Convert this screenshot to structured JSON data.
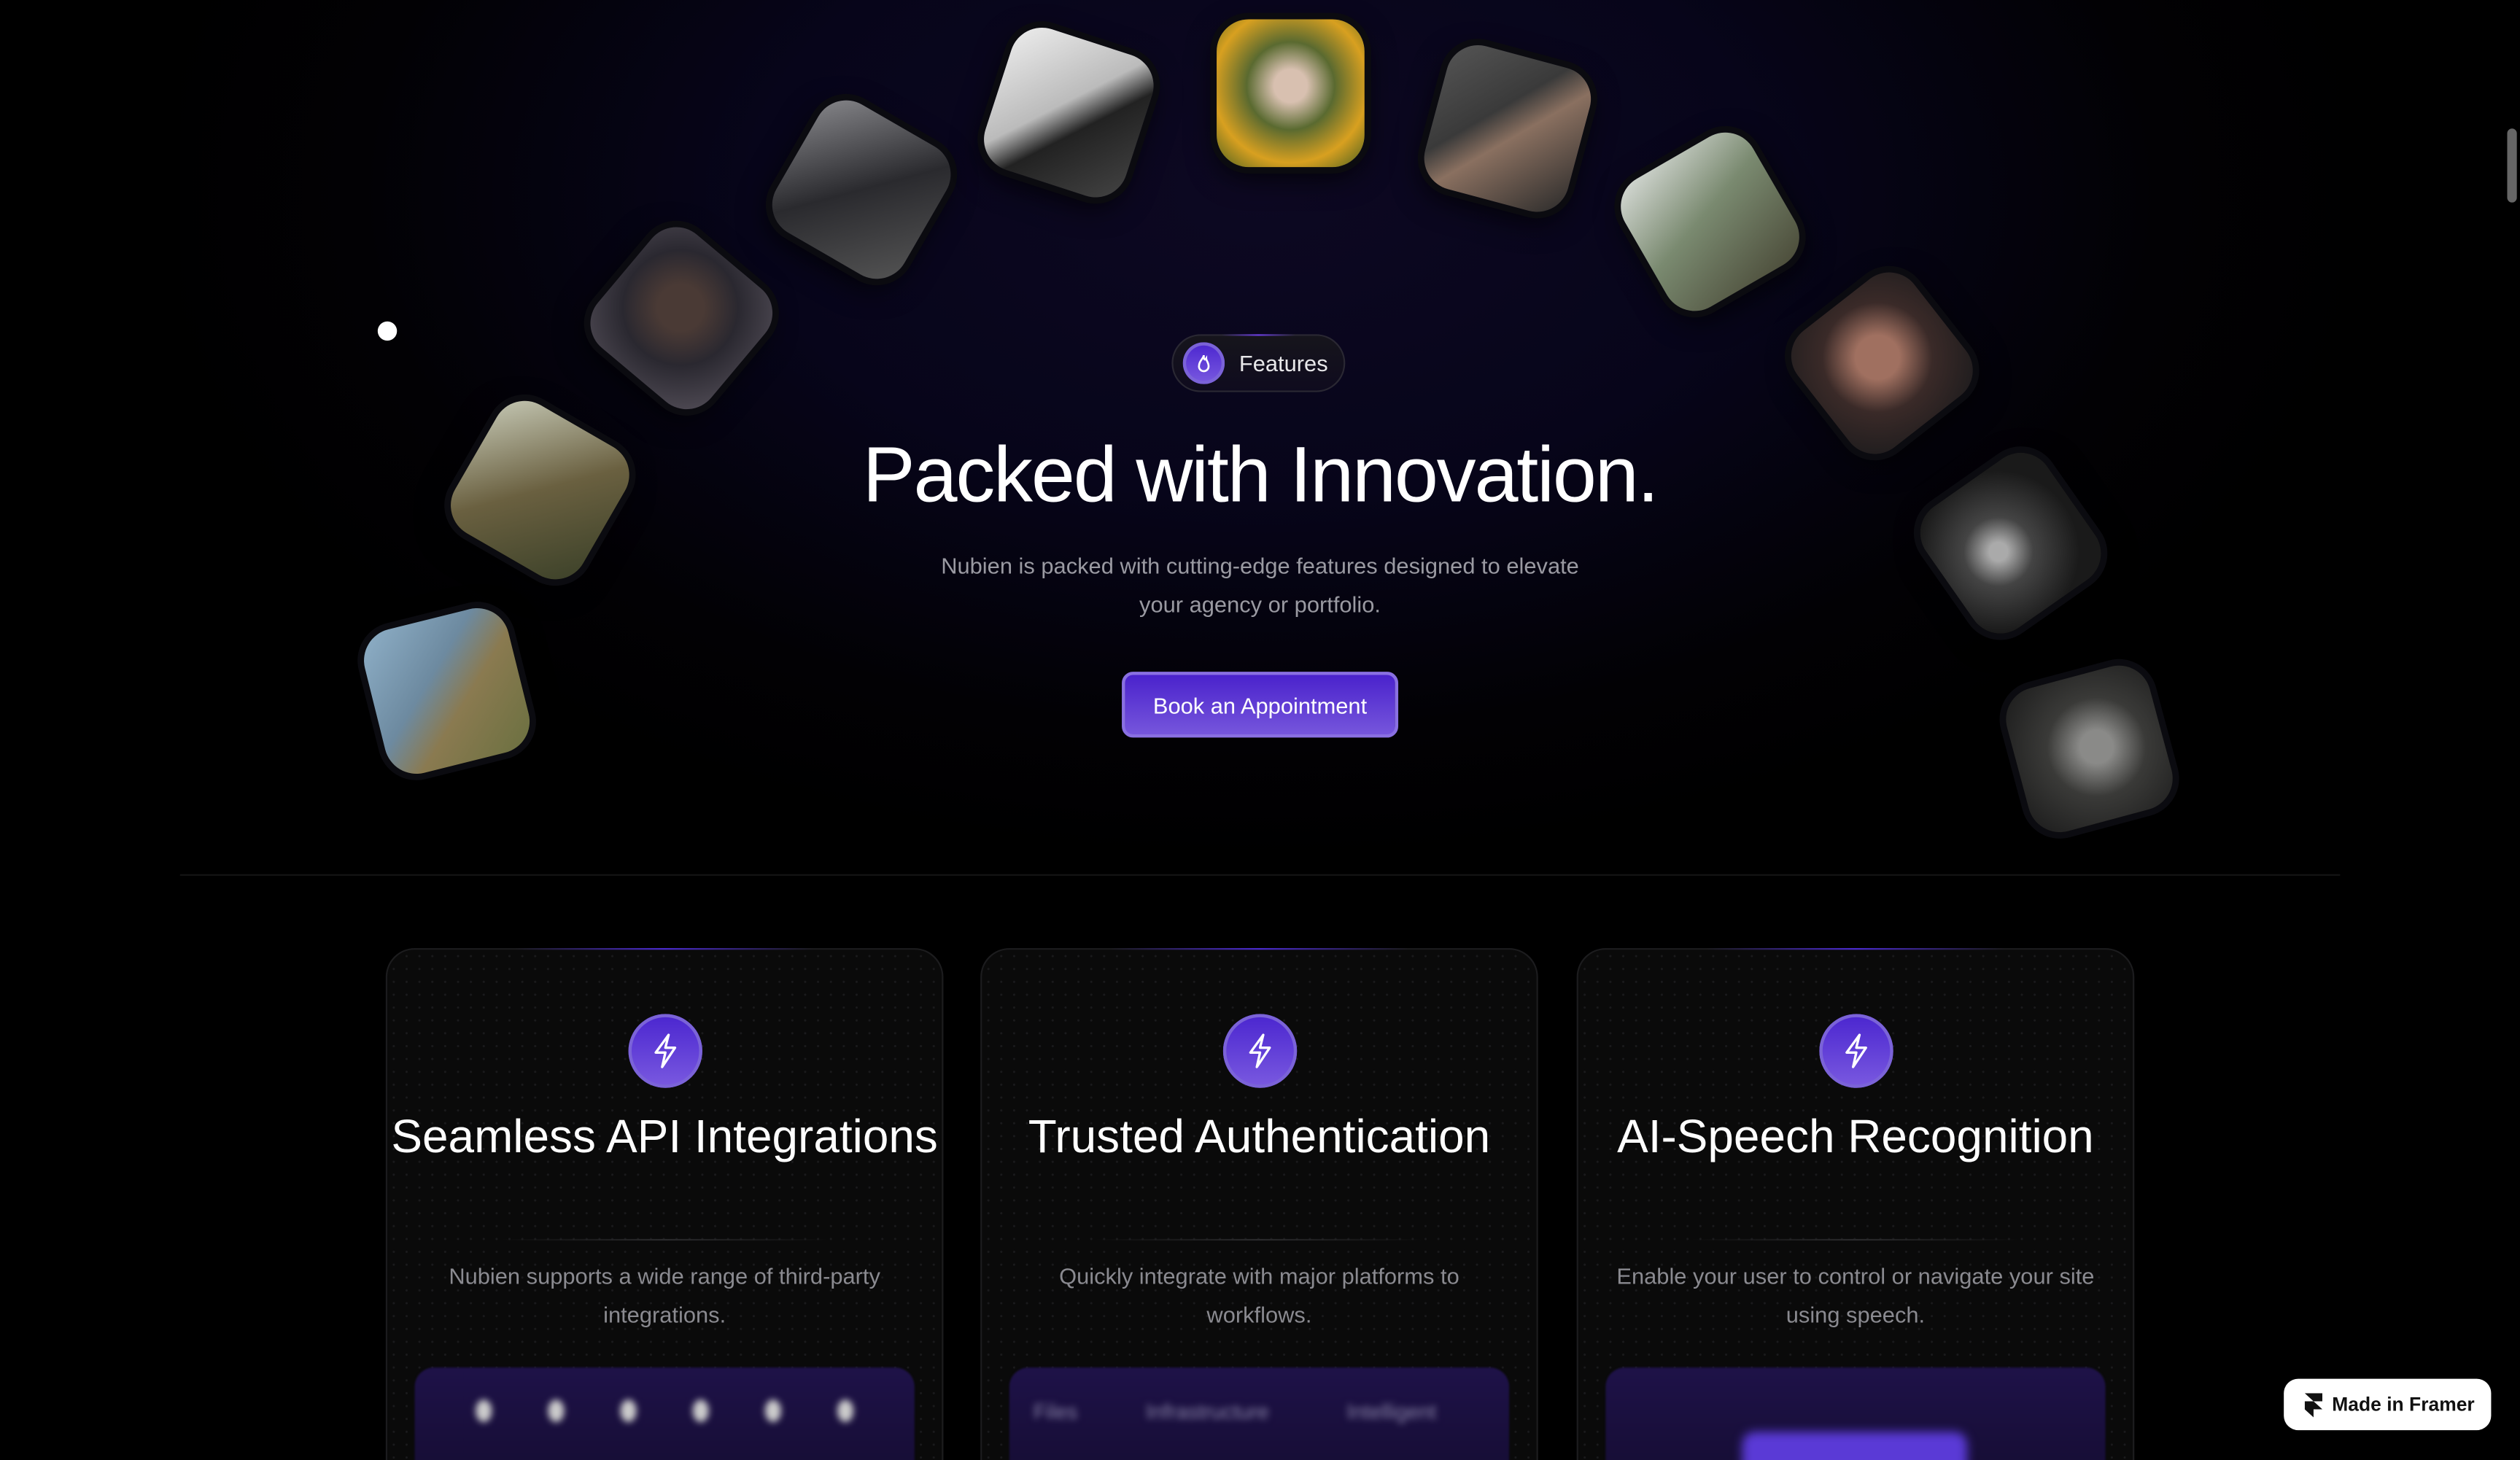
{
  "features_badge": {
    "label": "Features",
    "icon": "flame-icon"
  },
  "hero": {
    "title": "Packed with Innovation.",
    "subtitle": "Nubien is packed with cutting-edge features designed to elevate your agency or portfolio.",
    "cta_label": "Book an Appointment"
  },
  "cards": [
    {
      "title": "Seamless API Integrations",
      "description": "Nubien supports a wide range of third-party integrations.",
      "icon": "lightning-icon"
    },
    {
      "title": "Trusted Authentication",
      "description": "Quickly integrate with major platforms to workflows.",
      "icon": "lightning-icon"
    },
    {
      "title": "AI-Speech Recognition",
      "description": "Enable your user to control or navigate your site using speech.",
      "icon": "lightning-icon"
    }
  ],
  "card_preview": {
    "items": [
      "Files",
      "Infrastructure",
      "Intelligent"
    ]
  },
  "framer_badge": {
    "label": "Made in Framer"
  },
  "colors": {
    "accent": "#5b35d5",
    "background": "#000000"
  }
}
